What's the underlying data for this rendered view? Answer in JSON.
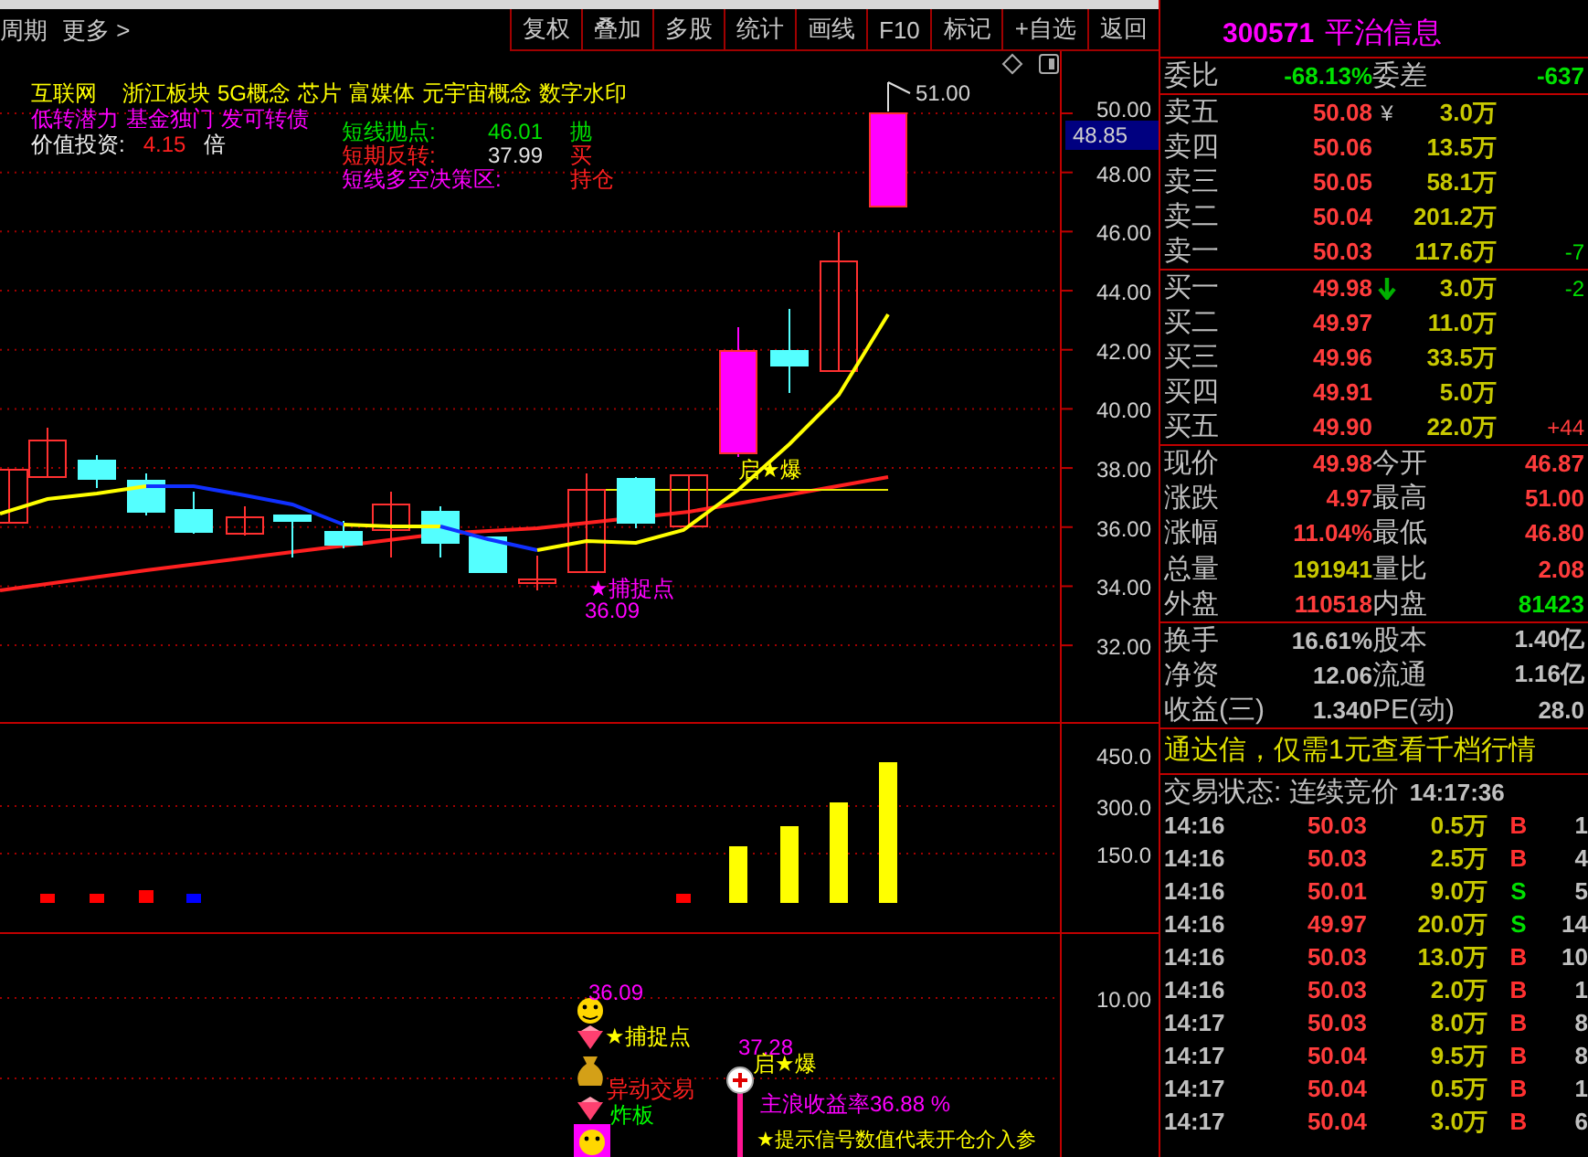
{
  "toolbar": {
    "left": [
      "周期",
      "更多 >"
    ],
    "buttons": [
      "复权",
      "叠加",
      "多股",
      "统计",
      "画线",
      "F10",
      "标记",
      "+自选",
      "返回"
    ]
  },
  "chart": {
    "concept_tags": [
      "互联网",
      "浙江板块",
      "5G概念",
      "芯片",
      "富媒体",
      "元宇宙概念",
      "数字水印"
    ],
    "feature_tags": [
      "低转潜力",
      "基金独门",
      "发可转债"
    ],
    "value_investing": {
      "label": "价值投资:",
      "value": "4.15",
      "unit": "倍"
    },
    "signals": [
      {
        "label": "短线抛点:",
        "value": "46.01",
        "action": "抛",
        "kind": "sell"
      },
      {
        "label": "短期反转:",
        "value": "37.99",
        "action": "买",
        "kind": "buy"
      },
      {
        "label": "短线多空决策区:",
        "action": "持仓",
        "kind": "zone"
      }
    ],
    "high_label": "51.00",
    "burst_label": "启★爆",
    "capture_label": "★捕捉点",
    "capture_price": "36.09",
    "price_axis": [
      "50.00",
      "48.00",
      "46.00",
      "44.00",
      "42.00",
      "40.00",
      "38.00",
      "36.00",
      "34.00",
      "32.00"
    ],
    "last_price": "48.85",
    "volume_axis": [
      "450.0",
      "300.0",
      "150.0"
    ],
    "signal_axis": [
      "10.00"
    ],
    "signal_pane": {
      "capture_price": "36.09",
      "capture": "★捕捉点",
      "unusual": "异动交易",
      "limit_break": "炸板",
      "burst_price": "37.28",
      "burst": "启★爆",
      "wave_return": "主浪收益率36.88 %",
      "note": "★提示信号数值代表开仓介入参"
    }
  },
  "stock_header": {
    "code": "300571",
    "name": "平治信息"
  },
  "order_ratio": [
    {
      "label": "委比",
      "value": "-68.13%"
    },
    {
      "label": "委差",
      "value": "-637"
    }
  ],
  "ask_rows": [
    {
      "label": "卖五",
      "mark": "¥",
      "price": "50.08",
      "volume": "3.0万"
    },
    {
      "label": "卖四",
      "price": "50.06",
      "volume": "13.5万"
    },
    {
      "label": "卖三",
      "price": "50.05",
      "volume": "58.1万"
    },
    {
      "label": "卖二",
      "price": "50.04",
      "volume": "201.2万"
    },
    {
      "label": "卖一",
      "price": "50.03",
      "volume": "117.6万",
      "change": "-7",
      "change_rising": false
    }
  ],
  "bid_rows": [
    {
      "label": "买一",
      "price": "49.98",
      "falling": true,
      "volume": "3.0万",
      "change": "-2",
      "change_rising": false
    },
    {
      "label": "买二",
      "price": "49.97",
      "volume": "11.0万"
    },
    {
      "label": "买三",
      "price": "49.96",
      "volume": "33.5万"
    },
    {
      "label": "买四",
      "price": "49.91",
      "volume": "5.0万"
    },
    {
      "label": "买五",
      "price": "49.90",
      "volume": "22.0万",
      "change": "+44",
      "change_rising": true
    }
  ],
  "quote_stats": [
    {
      "label": "现价",
      "value": "49.98",
      "kind": "up"
    },
    {
      "label": "今开",
      "value": "46.87",
      "kind": "up"
    },
    {
      "label": "涨跌",
      "value": "4.97",
      "kind": "up"
    },
    {
      "label": "最高",
      "value": "51.00",
      "kind": "up"
    },
    {
      "label": "涨幅",
      "value": "11.04%",
      "kind": "up"
    },
    {
      "label": "最低",
      "value": "46.80",
      "kind": "up"
    },
    {
      "label": "总量",
      "value": "191941",
      "kind": "volume"
    },
    {
      "label": "量比",
      "value": "2.08",
      "kind": "up"
    },
    {
      "label": "外盘",
      "value": "110518",
      "kind": "up"
    },
    {
      "label": "内盘",
      "value": "81423",
      "kind": "down"
    }
  ],
  "fundamentals": [
    {
      "label": "换手",
      "value": "16.61%"
    },
    {
      "label": "股本",
      "value": "1.40亿"
    },
    {
      "label": "净资",
      "value": "12.06"
    },
    {
      "label": "流通",
      "value": "1.16亿"
    },
    {
      "label": "收益(三)",
      "value": "1.340"
    },
    {
      "label": "PE(动)",
      "value": "28.0"
    }
  ],
  "promo": "通达信，仅需1元查看千档行情",
  "trading_status": {
    "label": "交易状态: 连续竞价",
    "time": "14:17:36"
  },
  "ticks": [
    {
      "time": "14:16",
      "price": "50.03",
      "volume": "0.5万",
      "side": "B",
      "kind": "buy",
      "count": "1"
    },
    {
      "time": "14:16",
      "price": "50.03",
      "volume": "2.5万",
      "side": "B",
      "kind": "buy",
      "count": "4"
    },
    {
      "time": "14:16",
      "price": "50.01",
      "volume": "9.0万",
      "side": "S",
      "kind": "sell",
      "count": "5"
    },
    {
      "time": "14:16",
      "price": "49.97",
      "volume": "20.0万",
      "side": "S",
      "kind": "sell",
      "count": "14"
    },
    {
      "time": "14:16",
      "price": "50.03",
      "volume": "13.0万",
      "side": "B",
      "kind": "buy",
      "count": "10"
    },
    {
      "time": "14:16",
      "price": "50.03",
      "volume": "2.0万",
      "side": "B",
      "kind": "buy",
      "count": "1"
    },
    {
      "time": "14:17",
      "price": "50.03",
      "volume": "8.0万",
      "side": "B",
      "kind": "buy",
      "count": "8"
    },
    {
      "time": "14:17",
      "price": "50.04",
      "volume": "9.5万",
      "side": "B",
      "kind": "buy",
      "count": "8"
    },
    {
      "time": "14:17",
      "price": "50.04",
      "volume": "0.5万",
      "side": "B",
      "kind": "buy",
      "count": "1"
    },
    {
      "time": "14:17",
      "price": "50.04",
      "volume": "3.0万",
      "side": "B",
      "kind": "buy",
      "count": "6"
    }
  ]
}
